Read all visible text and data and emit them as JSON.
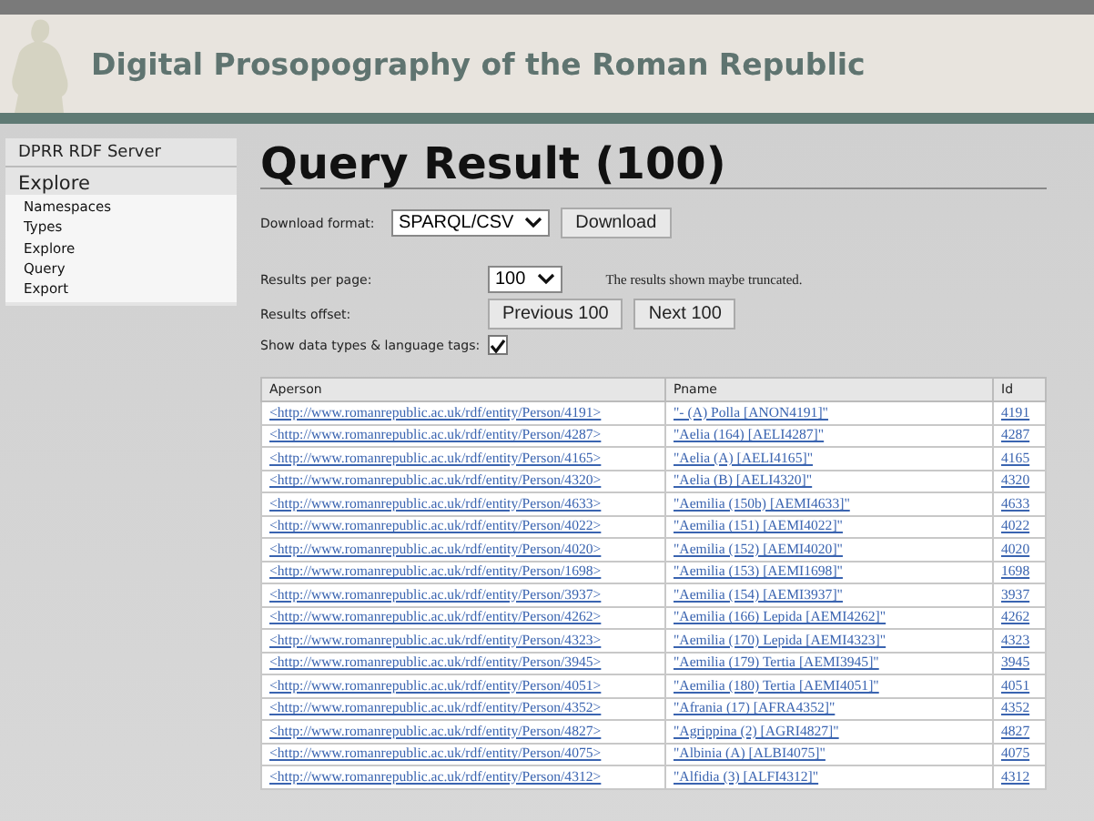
{
  "site_title": "Digital Prosopography of the Roman Republic",
  "sidebar": {
    "title": "DPRR RDF Server",
    "section": "Explore",
    "items": [
      {
        "label": "Namespaces"
      },
      {
        "label": "Types"
      },
      {
        "label": "Explore"
      },
      {
        "label": "Query"
      },
      {
        "label": "Export"
      }
    ]
  },
  "heading": "Query Result (100)",
  "download": {
    "label": "Download format:",
    "value": "SPARQL/CSV",
    "button": "Download"
  },
  "per_page": {
    "label": "Results per page:",
    "value": "100",
    "note": "The results shown maybe truncated."
  },
  "offset": {
    "label": "Results offset:",
    "buttons": [
      "Previous 100",
      "Next 100"
    ]
  },
  "show_types": {
    "label": "Show data types & language tags:",
    "checked": true
  },
  "table": {
    "columns": [
      "Aperson",
      "Pname",
      "Id"
    ],
    "rows": [
      [
        "<http://www.romanrepublic.ac.uk/rdf/entity/Person/4191>",
        "\"- (A) Polla [ANON4191]\"",
        "4191"
      ],
      [
        "<http://www.romanrepublic.ac.uk/rdf/entity/Person/4287>",
        "\"Aelia (164) [AELI4287]\"",
        "4287"
      ],
      [
        "<http://www.romanrepublic.ac.uk/rdf/entity/Person/4165>",
        "\"Aelia (A) [AELI4165]\"",
        "4165"
      ],
      [
        "<http://www.romanrepublic.ac.uk/rdf/entity/Person/4320>",
        "\"Aelia (B) [AELI4320]\"",
        "4320"
      ],
      [
        "<http://www.romanrepublic.ac.uk/rdf/entity/Person/4633>",
        "\"Aemilia (150b) [AEMI4633]\"",
        "4633"
      ],
      [
        "<http://www.romanrepublic.ac.uk/rdf/entity/Person/4022>",
        "\"Aemilia (151) [AEMI4022]\"",
        "4022"
      ],
      [
        "<http://www.romanrepublic.ac.uk/rdf/entity/Person/4020>",
        "\"Aemilia (152) [AEMI4020]\"",
        "4020"
      ],
      [
        "<http://www.romanrepublic.ac.uk/rdf/entity/Person/1698>",
        "\"Aemilia (153) [AEMI1698]\"",
        "1698"
      ],
      [
        "<http://www.romanrepublic.ac.uk/rdf/entity/Person/3937>",
        "\"Aemilia (154) [AEMI3937]\"",
        "3937"
      ],
      [
        "<http://www.romanrepublic.ac.uk/rdf/entity/Person/4262>",
        "\"Aemilia (166) Lepida [AEMI4262]\"",
        "4262"
      ],
      [
        "<http://www.romanrepublic.ac.uk/rdf/entity/Person/4323>",
        "\"Aemilia (170) Lepida [AEMI4323]\"",
        "4323"
      ],
      [
        "<http://www.romanrepublic.ac.uk/rdf/entity/Person/3945>",
        "\"Aemilia (179) Tertia [AEMI3945]\"",
        "3945"
      ],
      [
        "<http://www.romanrepublic.ac.uk/rdf/entity/Person/4051>",
        "\"Aemilia (180) Tertia [AEMI4051]\"",
        "4051"
      ],
      [
        "<http://www.romanrepublic.ac.uk/rdf/entity/Person/4352>",
        "\"Afrania (17) [AFRA4352]\"",
        "4352"
      ],
      [
        "<http://www.romanrepublic.ac.uk/rdf/entity/Person/4827>",
        "\"Agrippina (2) [AGRI4827]\"",
        "4827"
      ],
      [
        "<http://www.romanrepublic.ac.uk/rdf/entity/Person/4075>",
        "\"Albinia (A) [ALBI4075]\"",
        "4075"
      ],
      [
        "<http://www.romanrepublic.ac.uk/rdf/entity/Person/4312>",
        "\"Alfidia (3) [ALFI4312]\"",
        "4312"
      ]
    ]
  }
}
